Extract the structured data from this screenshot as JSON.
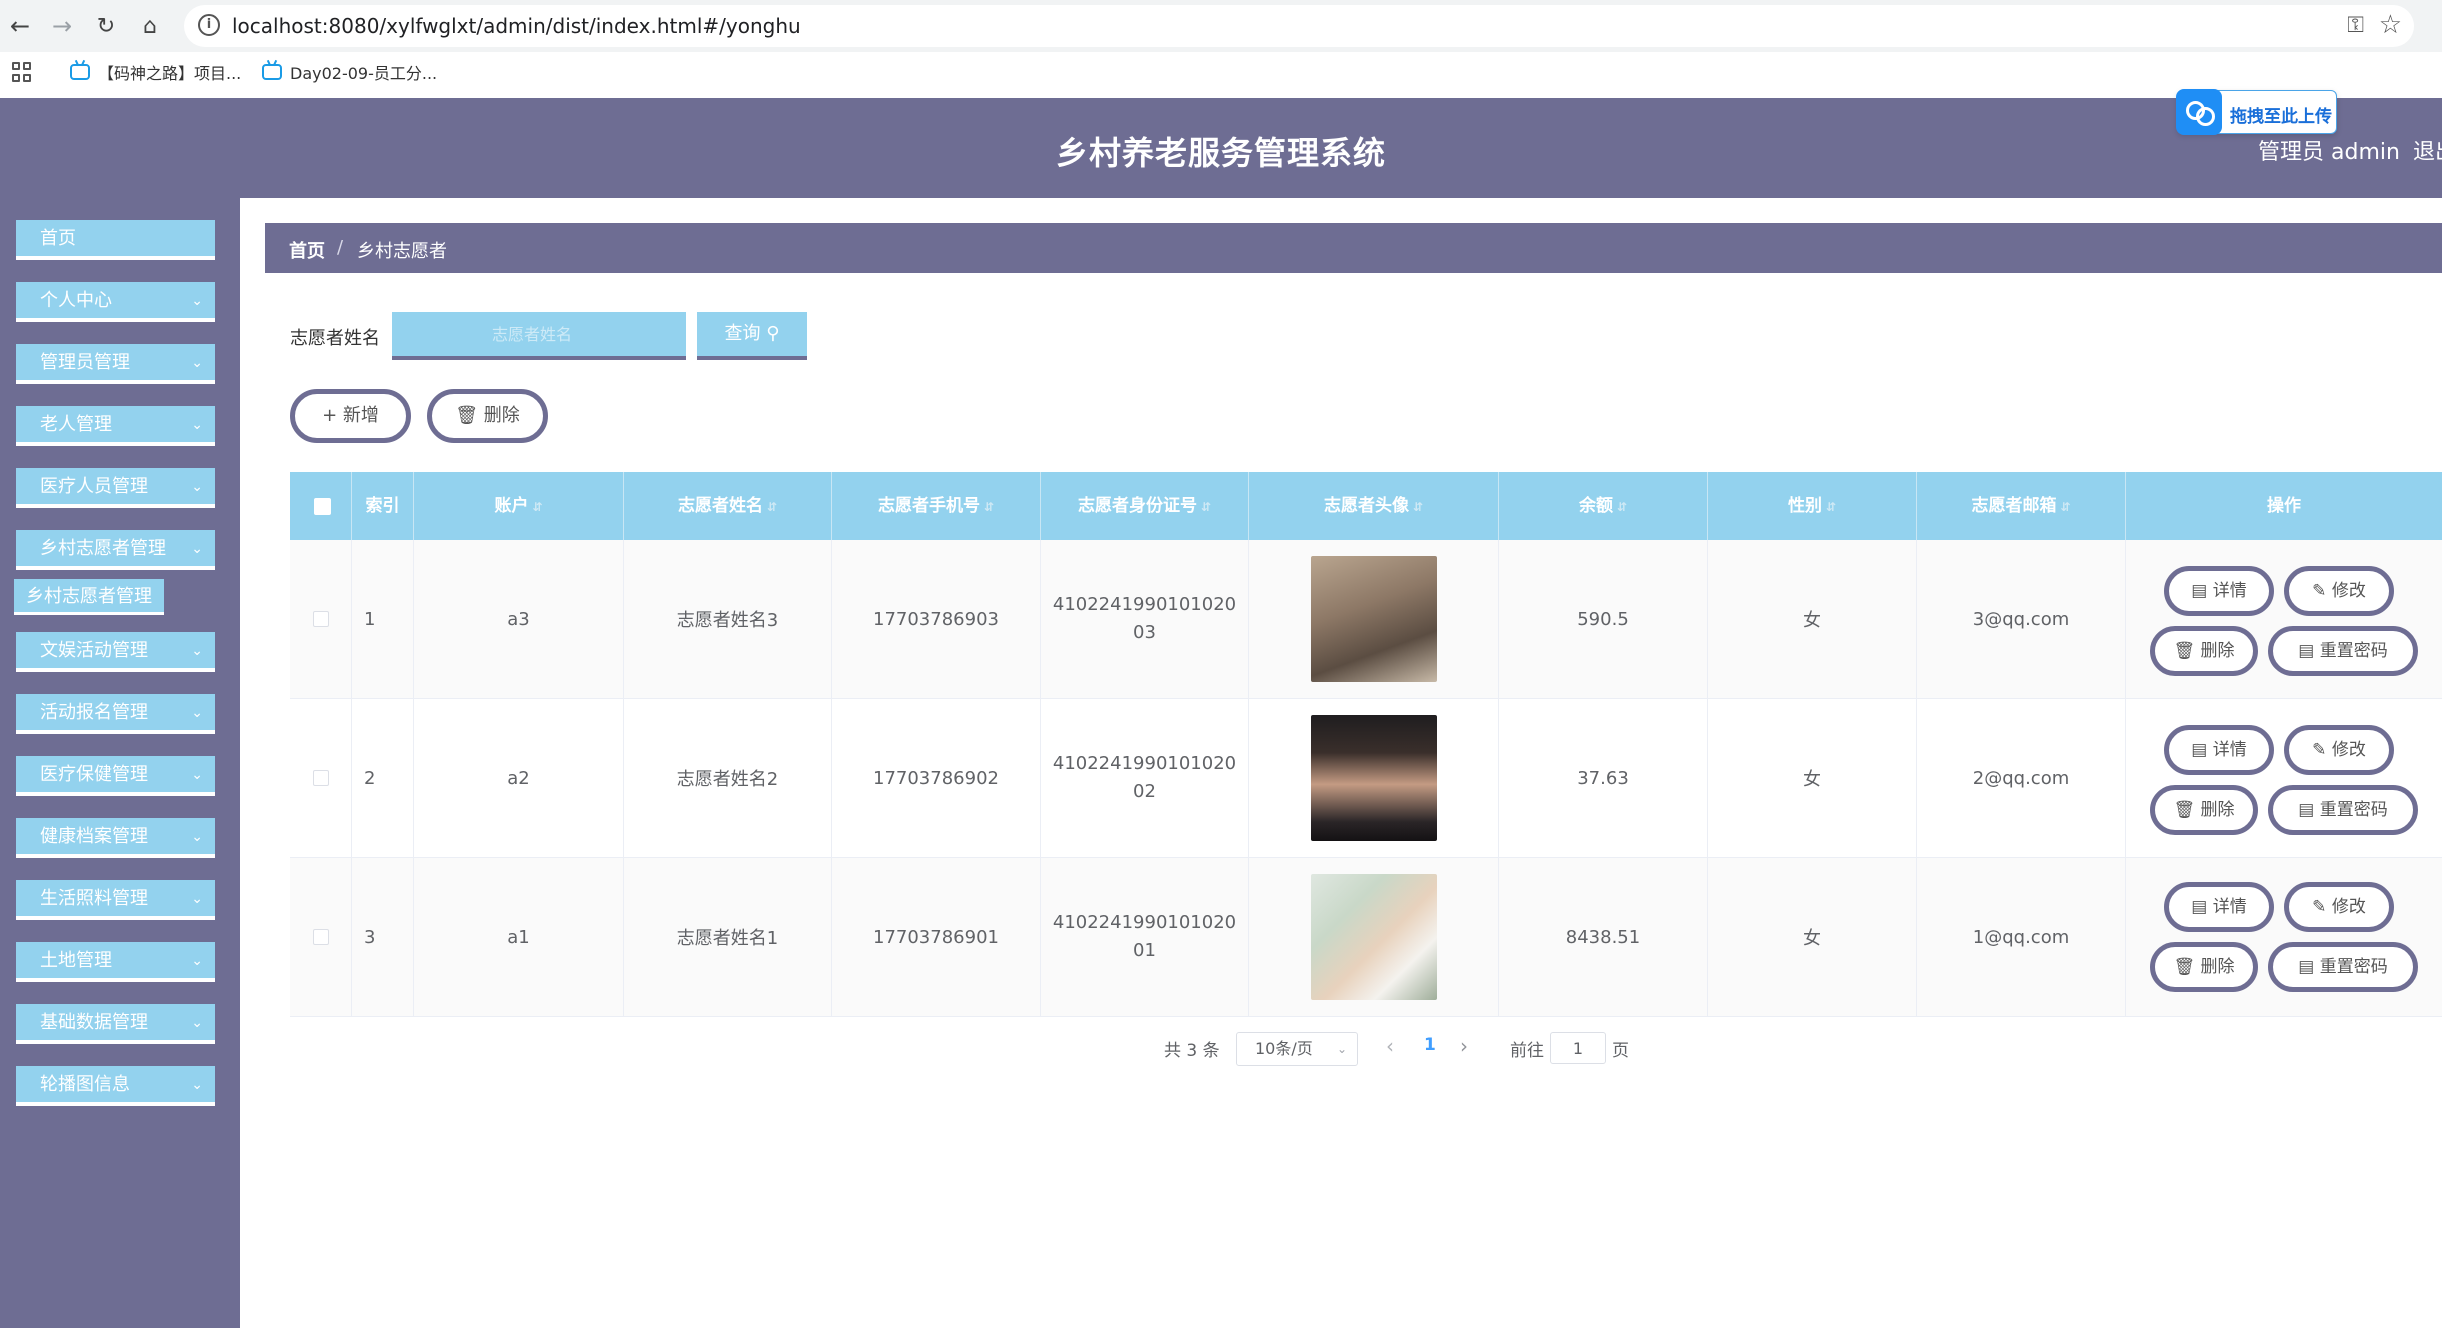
{
  "browser": {
    "url": "localhost:8080/xylfwglxt/admin/dist/index.html#/yonghu",
    "bookmarks": [
      "【码神之路】项目...",
      "Day02-09-员工分..."
    ]
  },
  "header": {
    "title": "乡村养老服务管理系统",
    "admin": "管理员 admin",
    "logout": "退出",
    "upload_badge": "拖拽至此上传"
  },
  "sidebar": {
    "items": [
      {
        "label": "首页",
        "has_chevron": false
      },
      {
        "label": "个人中心",
        "has_chevron": true
      },
      {
        "label": "管理员管理",
        "has_chevron": true
      },
      {
        "label": "老人管理",
        "has_chevron": true
      },
      {
        "label": "医疗人员管理",
        "has_chevron": true
      },
      {
        "label": "乡村志愿者管理",
        "has_chevron": true
      },
      {
        "label": "文娱活动管理",
        "has_chevron": true
      },
      {
        "label": "活动报名管理",
        "has_chevron": true
      },
      {
        "label": "医疗保健管理",
        "has_chevron": true
      },
      {
        "label": "健康档案管理",
        "has_chevron": true
      },
      {
        "label": "生活照料管理",
        "has_chevron": true
      },
      {
        "label": "土地管理",
        "has_chevron": true
      },
      {
        "label": "基础数据管理",
        "has_chevron": true
      },
      {
        "label": "轮播图信息",
        "has_chevron": true
      }
    ],
    "submenu": "乡村志愿者管理"
  },
  "breadcrumb": {
    "home": "首页",
    "separator": "/",
    "current": "乡村志愿者"
  },
  "search": {
    "label": "志愿者姓名",
    "placeholder": "志愿者姓名",
    "value": "",
    "button": "查询"
  },
  "actions": {
    "add": "新增",
    "delete": "删除"
  },
  "table": {
    "columns": [
      "索引",
      "账户",
      "志愿者姓名",
      "志愿者手机号",
      "志愿者身份证号",
      "志愿者头像",
      "余额",
      "性别",
      "志愿者邮箱",
      "操作"
    ],
    "rows": [
      {
        "index": "1",
        "account": "a3",
        "name": "志愿者姓名3",
        "phone": "17703786903",
        "id_card": "410224199010102003",
        "avatar": "photo-1",
        "balance": "590.5",
        "gender": "女",
        "email": "3@qq.com"
      },
      {
        "index": "2",
        "account": "a2",
        "name": "志愿者姓名2",
        "phone": "17703786902",
        "id_card": "410224199010102002",
        "avatar": "photo-2",
        "balance": "37.63",
        "gender": "女",
        "email": "2@qq.com"
      },
      {
        "index": "3",
        "account": "a1",
        "name": "志愿者姓名1",
        "phone": "17703786901",
        "id_card": "410224199010102001",
        "avatar": "photo-3",
        "balance": "8438.51",
        "gender": "女",
        "email": "1@qq.com"
      }
    ],
    "row_actions": {
      "detail": "详情",
      "edit": "修改",
      "delete": "删除",
      "reset": "重置密码"
    }
  },
  "pagination": {
    "total": "共 3 条",
    "page_size": "10条/页",
    "current_page": "1",
    "goto_label": "前往",
    "goto_value": "1",
    "goto_unit": "页"
  },
  "colors": {
    "theme": "#6e6d93",
    "accent": "#93d2ee",
    "link": "#409eff"
  }
}
